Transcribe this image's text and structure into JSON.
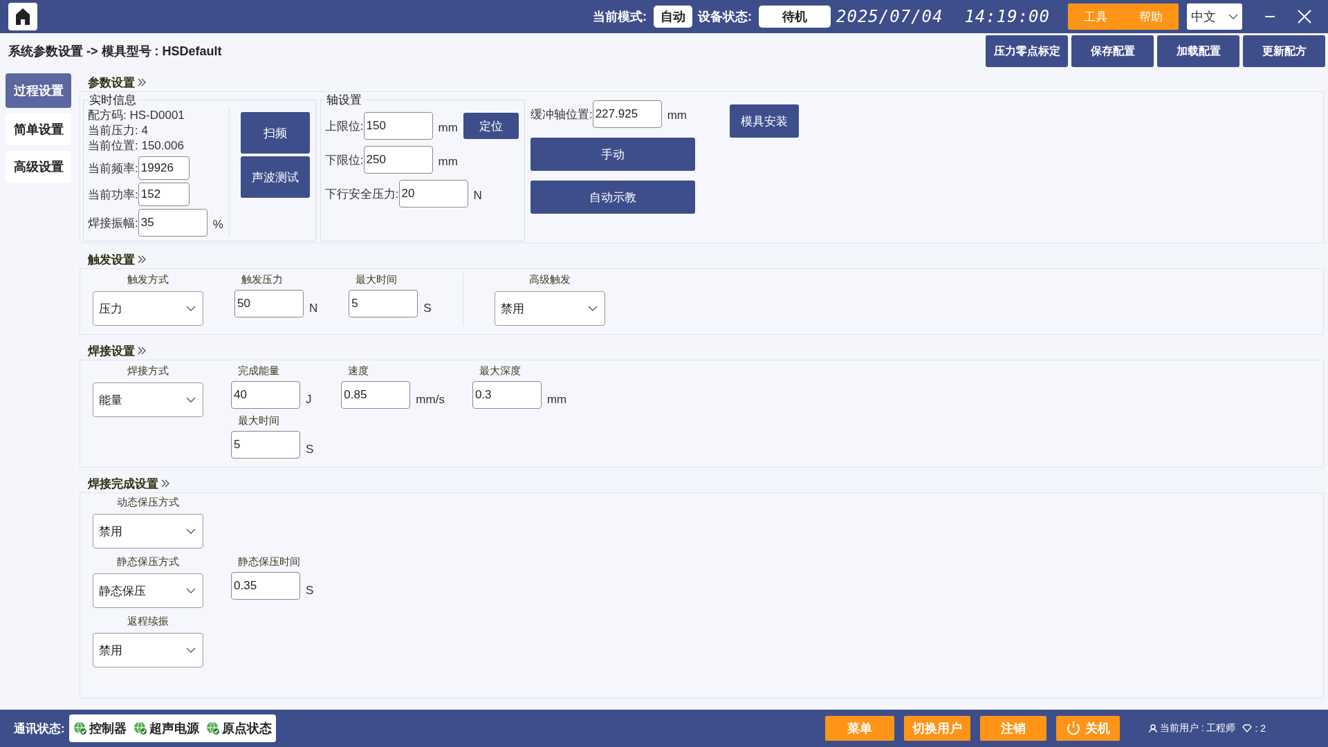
{
  "header": {
    "mode_label": "当前模式:",
    "mode": "自动",
    "status_label": "设备状态:",
    "status": "待机",
    "datetime": "2025/07/04  14:19:00",
    "menu_buttons": [
      "工具",
      "帮助"
    ],
    "language": "中文"
  },
  "breadcrumb": "系统参数设置 -> 模具型号 : HSDefault",
  "actions": [
    "压力零点标定",
    "保存配置",
    "加载配置",
    "更新配方"
  ],
  "nav": [
    {
      "label": "过程设置",
      "selected": true
    },
    {
      "label": "简单设置",
      "selected": false
    },
    {
      "label": "高级设置",
      "selected": false
    }
  ],
  "params": {
    "title": "参数设置",
    "realtime": {
      "title": "实时信息",
      "lines": [
        "配方码: HS-D0001",
        "当前压力: 4",
        "当前位置: 150.006"
      ],
      "fields": [
        {
          "label": "当前频率:",
          "value": "19926"
        },
        {
          "label": "当前功率:",
          "value": "152"
        },
        {
          "label": "焊接振幅:",
          "value": "35",
          "unit": "%"
        }
      ],
      "buttons": [
        "扫频",
        "声波测试"
      ]
    },
    "axis": {
      "title": "轴设置",
      "fields": [
        {
          "label": "上限位:",
          "value": "150",
          "unit": "mm"
        },
        {
          "label": "下限位:",
          "value": "250",
          "unit": "mm"
        },
        {
          "label": "下行安全压力:",
          "value": "20",
          "unit": "N"
        }
      ],
      "locate": "定位"
    },
    "buffer": {
      "label": "缓冲轴位置:",
      "value": "227.925",
      "unit": "mm"
    },
    "buttons": [
      "手动",
      "自动示教"
    ],
    "mold_button": "模具安装"
  },
  "trigger": {
    "title": "触发设置",
    "columns": [
      [
        {
          "kind": "select",
          "label": "触发方式",
          "value": "压力"
        }
      ],
      [
        {
          "kind": "input",
          "label": "触发压力",
          "value": "50",
          "unit": "N"
        }
      ],
      [
        {
          "kind": "input",
          "label": "最大时间",
          "value": "5",
          "unit": "S"
        }
      ]
    ],
    "advanced": {
      "kind": "select",
      "label": "高级触发",
      "value": "禁用"
    }
  },
  "weld": {
    "title": "焊接设置",
    "columns": [
      [
        {
          "kind": "select",
          "label": "焊接方式",
          "value": "能量"
        }
      ],
      [
        {
          "kind": "input",
          "label": "完成能量",
          "value": "40",
          "unit": "J"
        },
        {
          "kind": "input",
          "label": "最大时间",
          "value": "5",
          "unit": "S"
        }
      ],
      [
        {
          "kind": "input",
          "label": "速度",
          "value": "0.85",
          "unit": "mm/s"
        }
      ],
      [
        {
          "kind": "input",
          "label": "最大深度",
          "value": "0.3",
          "unit": "mm"
        }
      ]
    ]
  },
  "completion": {
    "title": "焊接完成设置",
    "rows": [
      [
        {
          "kind": "select",
          "label": "动态保压方式",
          "value": "禁用"
        }
      ],
      [
        {
          "kind": "select",
          "label": "静态保压方式",
          "value": "静态保压"
        },
        {
          "kind": "input",
          "label": "静态保压时间",
          "value": "0.35",
          "unit": "S"
        }
      ],
      [
        {
          "kind": "select",
          "label": "返程续振",
          "value": "禁用"
        }
      ]
    ]
  },
  "status_bar": {
    "label": "通讯状态:",
    "links": [
      "控制器",
      "超声电源",
      "原点状态"
    ],
    "buttons": [
      {
        "kind": "text",
        "label": "菜单"
      },
      {
        "kind": "text",
        "label": "切换用户"
      },
      {
        "kind": "text",
        "label": "注销"
      },
      {
        "kind": "power",
        "label": "关机"
      }
    ],
    "user": "当前用户 : 工程师",
    "level": ": 2"
  }
}
